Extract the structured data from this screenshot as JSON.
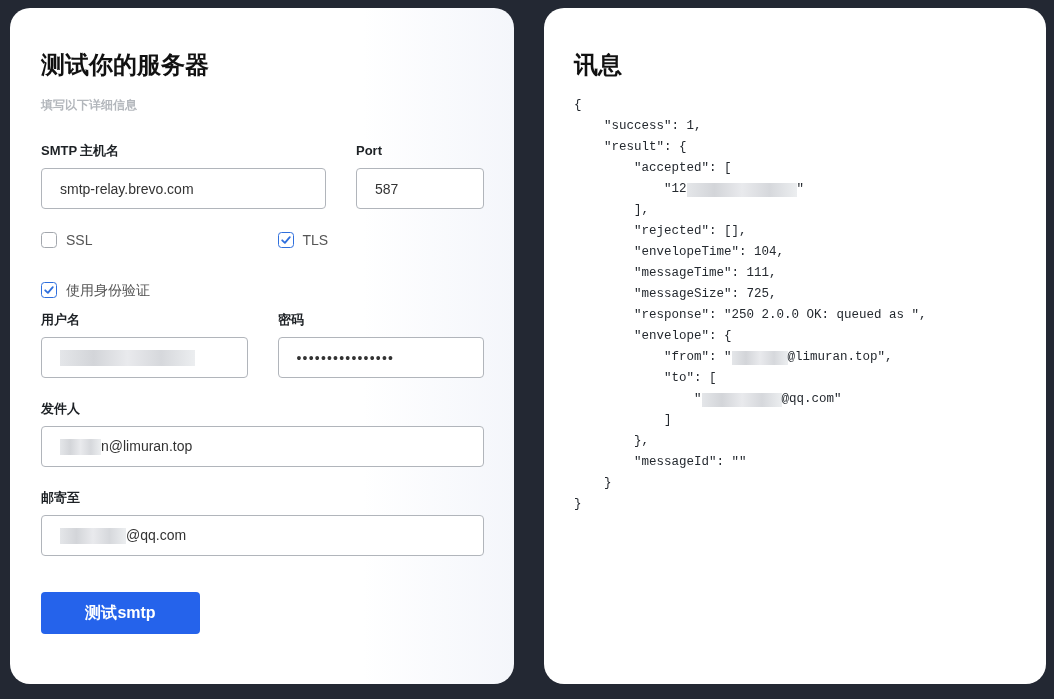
{
  "form": {
    "title": "测试你的服务器",
    "subtitle": "填写以下详细信息",
    "host": {
      "label": "SMTP 主机名",
      "value": "smtp-relay.brevo.com",
      "redacted": false
    },
    "port": {
      "label": "Port",
      "value": "587",
      "redacted": false
    },
    "security_options": [
      {
        "label": "SSL",
        "checked": false
      },
      {
        "label": "TLS",
        "checked": true
      }
    ],
    "auth_option": {
      "label": "使用身份验证",
      "checked": true
    },
    "username": {
      "label": "用户名",
      "redacted": true
    },
    "password": {
      "label": "密码",
      "value": "••••••••••••••••",
      "redacted": false
    },
    "sender": {
      "label": "发件人",
      "value": "n@limuran.top",
      "redacted": true
    },
    "recipient": {
      "label": "邮寄至",
      "value": "@qq.com",
      "redacted": true
    },
    "submit_button": {
      "label": "测试smtp"
    }
  },
  "response": {
    "title": "讯息",
    "lines": [
      {
        "text": "{",
        "redacted": false,
        "children": [
          {
            "text": "\"success\": 1,",
            "redacted": false
          },
          {
            "text": "\"result\": {",
            "redacted": false,
            "children": [
              {
                "text": "\"accepted\": [",
                "redacted": false,
                "children": [
                  {
                    "text": "\"12",
                    "redacted": true,
                    "after": "\""
                  }
                ]
              },
              {
                "text": "],",
                "redacted": false
              },
              {
                "text": "\"rejected\": [],",
                "redacted": false
              },
              {
                "text": "\"envelopeTime\": 104,",
                "redacted": false
              },
              {
                "text": "\"messageTime\": 111,",
                "redacted": false
              },
              {
                "text": "\"messageSize\": 725,",
                "redacted": false
              },
              {
                "text": "\"response\": \"250 2.0.0 OK: queued as \",",
                "redacted": false
              },
              {
                "text": "\"envelope\": {",
                "redacted": false,
                "children": [
                  {
                    "text": "\"from\": \"",
                    "redacted": true,
                    "after": "@limuran.top\","
                  },
                  {
                    "text": "\"to\": [",
                    "redacted": false,
                    "children": [
                      {
                        "text": "\"",
                        "redacted": true,
                        "after": "@qq.com\""
                      }
                    ]
                  },
                  {
                    "text": "]",
                    "redacted": false
                  }
                ]
              },
              {
                "text": "},",
                "redacted": false
              },
              {
                "text": "\"messageId\": \"\"",
                "redacted": false
              }
            ]
          },
          {
            "text": "}",
            "redacted": false
          }
        ]
      },
      {
        "text": "}",
        "redacted": false
      }
    ]
  }
}
